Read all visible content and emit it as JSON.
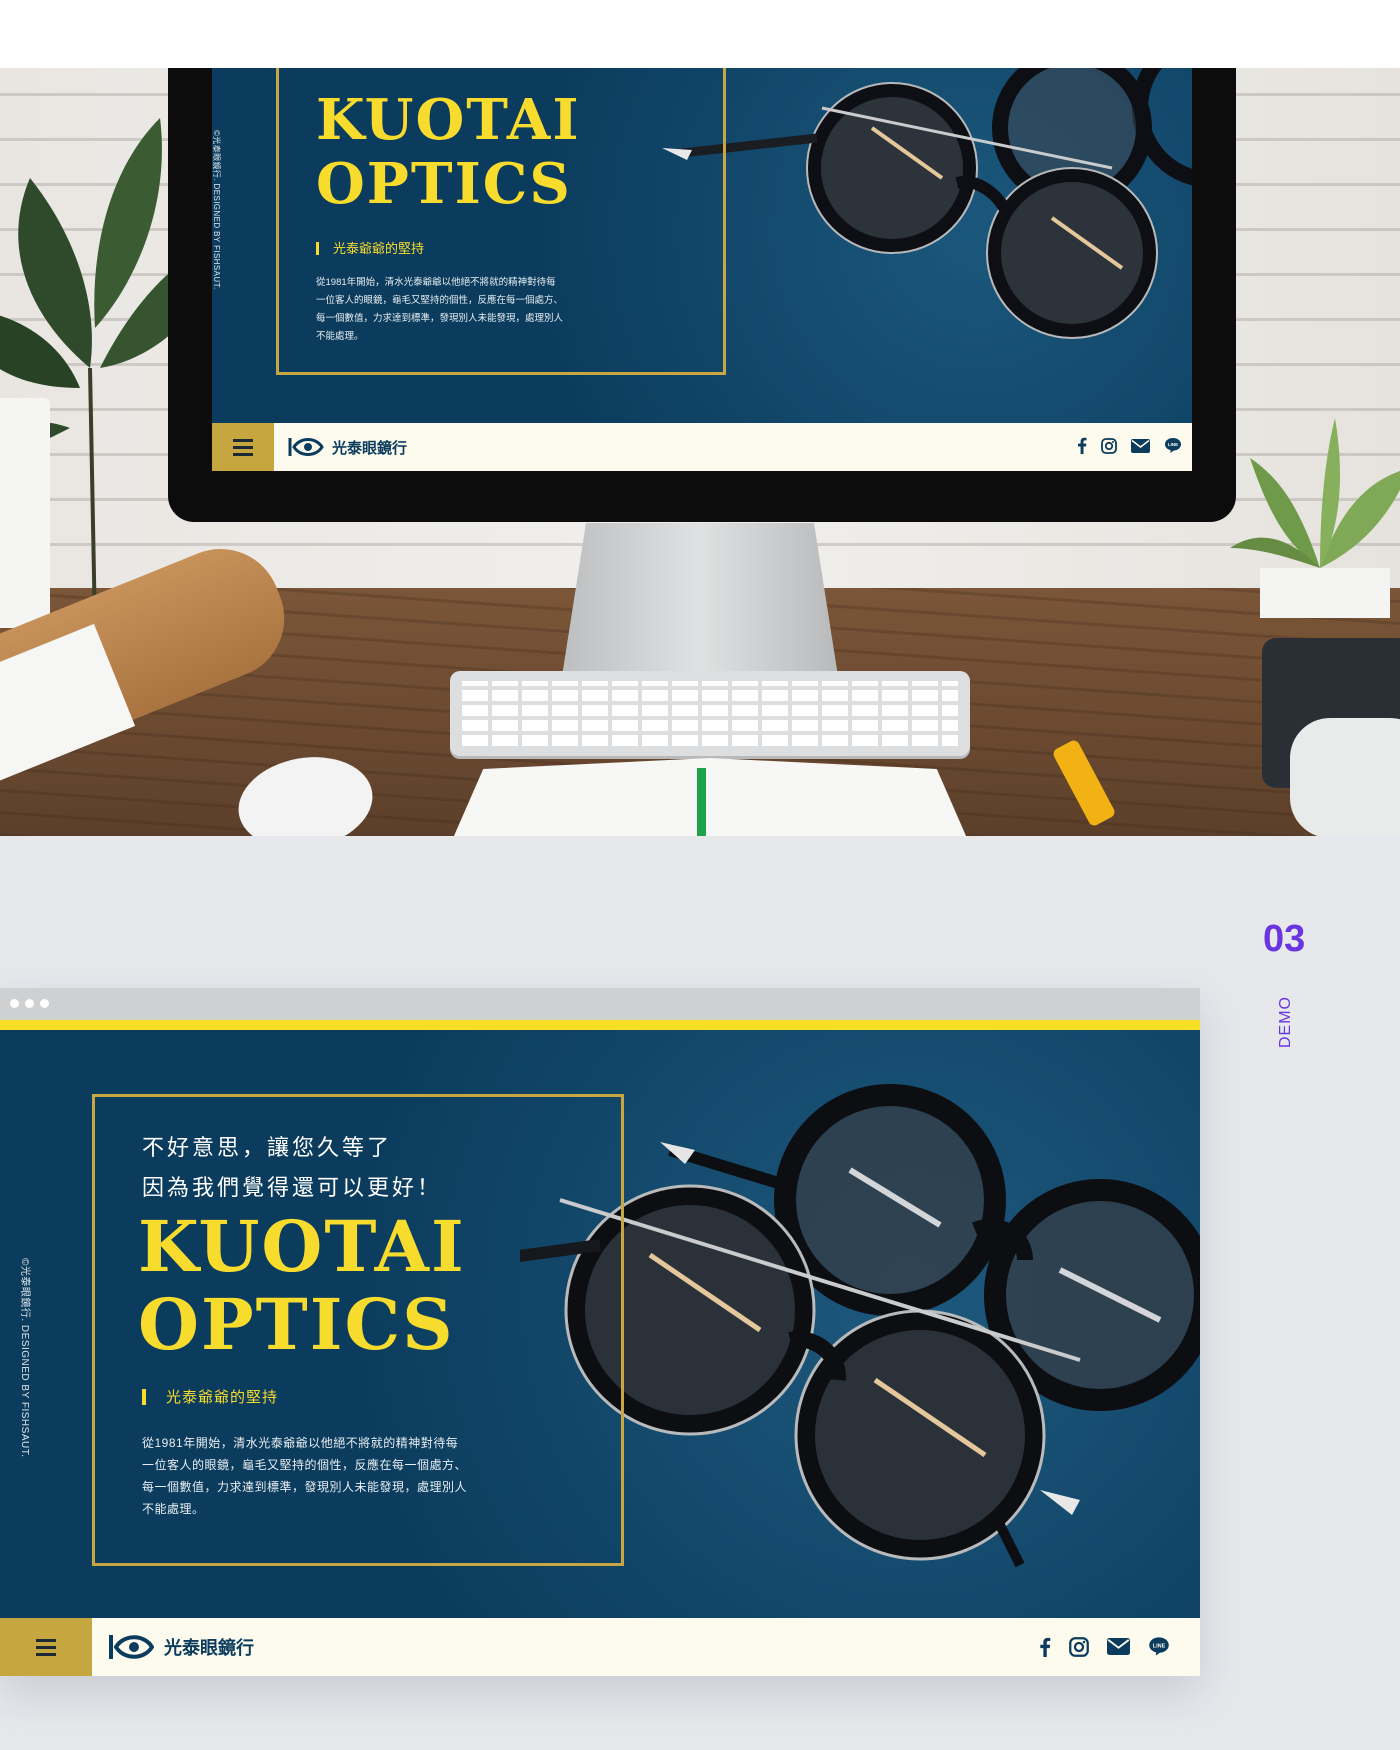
{
  "monitor_site": {
    "title_line1": "KUOTAI",
    "title_line2": "OPTICS",
    "subtitle": "光泰爺爺的堅持",
    "body_lines": [
      "從1981年開始，清水光泰爺爺以他絕不將就的精神對待每",
      "一位客人的眼鏡，龜毛又堅持的個性，反應在每一個處方、",
      "每一個數值，力求達到標準，發現別人未能發現，處理別人",
      "不能處理。"
    ],
    "copyright": "©光泰眼鏡行. DESIGNED BY FISHSAUT.",
    "brand_name": "光泰眼鏡行"
  },
  "section": {
    "number": "03",
    "label": "DEMO"
  },
  "browser_site": {
    "intro_line1": "不好意思，讓您久等了",
    "intro_line2": "因為我們覺得還可以更好！",
    "title_line1": "KUOTAI",
    "title_line2": "OPTICS",
    "subtitle": "光泰爺爺的堅持",
    "body_lines": [
      "從1981年開始，清水光泰爺爺以他絕不將就的精神對待每",
      "一位客人的眼鏡，龜毛又堅持的個性，反應在每一個處方、",
      "每一個數值，力求達到標準，發現別人未能發現，處理別人",
      "不能處理。"
    ],
    "copyright": "©光泰眼鏡行. DESIGNED BY FISHSAUT.",
    "brand_name": "光泰眼鏡行",
    "social_icons": [
      "facebook-icon",
      "instagram-icon",
      "mail-icon",
      "line-icon"
    ]
  },
  "colors": {
    "navy": "#0b3c5d",
    "yellow": "#f8dc2d",
    "gold": "#c6a63e",
    "accent_purple": "#6a35e0",
    "cream": "#fdfbee"
  }
}
